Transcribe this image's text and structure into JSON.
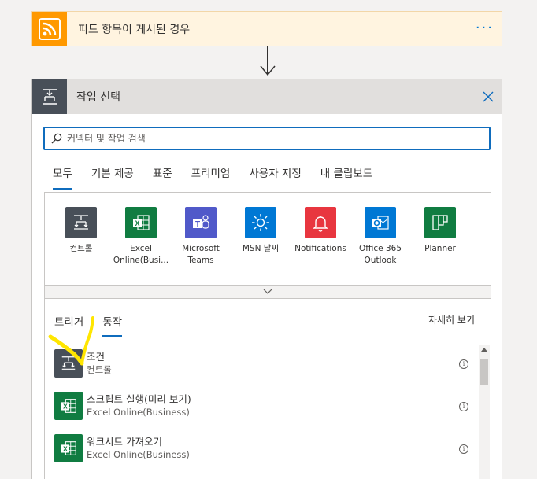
{
  "trigger": {
    "title": "피드 항목이 게시된 경우",
    "more": "···"
  },
  "action_panel": {
    "title": "작업 선택",
    "search_placeholder": "커넥터 및 작업 검색",
    "tabs": [
      "모두",
      "기본 제공",
      "표준",
      "프리미엄",
      "사용자 지정",
      "내 클립보드"
    ],
    "active_tab": 0,
    "connectors": [
      {
        "label": "컨트롤",
        "color": "#484f58",
        "icon": "control-icon"
      },
      {
        "label": "Excel Online(Busi...",
        "color": "#107c41",
        "icon": "excel-icon"
      },
      {
        "label": "Microsoft Teams",
        "color": "#5059c9",
        "icon": "teams-icon"
      },
      {
        "label": "MSN 날씨",
        "color": "#0078d4",
        "icon": "weather-icon"
      },
      {
        "label": "Notifications",
        "color": "#e8363f",
        "icon": "bell-icon"
      },
      {
        "label": "Office 365 Outlook",
        "color": "#0078d4",
        "icon": "outlook-icon"
      },
      {
        "label": "Planner",
        "color": "#107c41",
        "icon": "planner-icon"
      }
    ],
    "sub_tabs": [
      "트리거",
      "동작"
    ],
    "active_sub_tab": 1,
    "see_more": "자세히 보기",
    "results": [
      {
        "title": "조건",
        "subtitle": "컨트롤",
        "color": "#484f58",
        "icon": "control-icon"
      },
      {
        "title": "스크립트 실행(미리 보기)",
        "subtitle": "Excel Online(Business)",
        "color": "#107c41",
        "icon": "excel-icon"
      },
      {
        "title": "워크시트 가져오기",
        "subtitle": "Excel Online(Business)",
        "color": "#107c41",
        "icon": "excel-icon"
      }
    ]
  },
  "colors": {
    "accent": "#0f6cbd",
    "trigger_bg": "#fff4e0",
    "rss": "#ff9900",
    "highlight": "#ffe600"
  }
}
